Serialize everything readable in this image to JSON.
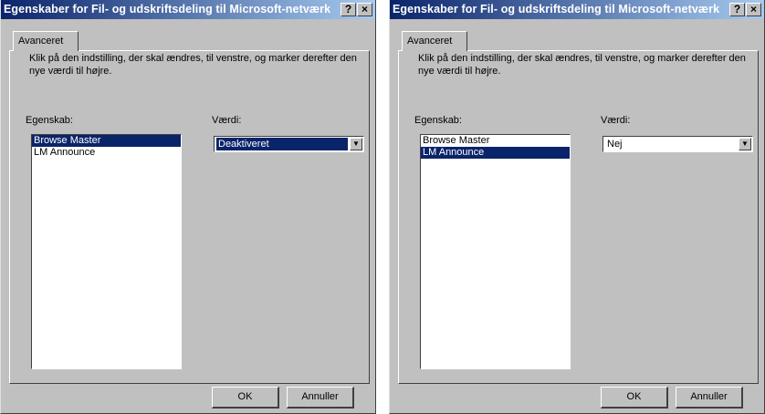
{
  "windows": [
    {
      "title": "Egenskaber for Fil- og udskriftsdeling til Microsoft-netværk",
      "help_label": "?",
      "close_label": "×",
      "tab_label": "Avanceret",
      "instructions": "Klik på den indstilling, der skal ændres, til venstre, og marker derefter den nye værdi til højre.",
      "property_label": "Egenskab:",
      "value_label": "Værdi:",
      "list_items": [
        "Browse Master",
        "LM Announce"
      ],
      "selected_item": "Browse Master",
      "value": "Deaktiveret",
      "ok_label": "OK",
      "cancel_label": "Annuller"
    },
    {
      "title": "Egenskaber for Fil- og udskriftsdeling til Microsoft-netværk",
      "help_label": "?",
      "close_label": "×",
      "tab_label": "Avanceret",
      "instructions": "Klik på den indstilling, der skal ændres, til venstre, og marker derefter den nye værdi til højre.",
      "property_label": "Egenskab:",
      "value_label": "Værdi:",
      "list_items": [
        "Browse Master",
        "LM Announce"
      ],
      "selected_item": "LM Announce",
      "value": "Nej",
      "ok_label": "OK",
      "cancel_label": "Annuller"
    }
  ],
  "colors": {
    "title_gradient_start": "#0a246a",
    "title_gradient_end": "#a6caf0",
    "selection": "#0a246a",
    "face": "#c0c0c0"
  },
  "icons": [
    "help-icon",
    "close-icon",
    "dropdown-arrow-icon"
  ]
}
